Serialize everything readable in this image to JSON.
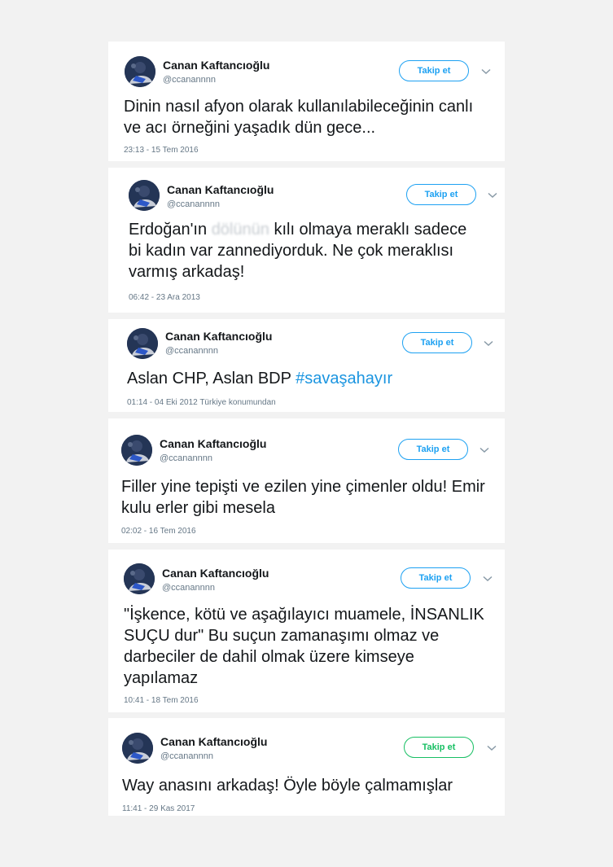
{
  "colors": {
    "accent": "#1da1f2",
    "hashtag": "#1b95e0",
    "follow_green": "#17bf63",
    "meta": "#657786"
  },
  "tweets": [
    {
      "name": "Canan Kaftancıoğlu",
      "handle": "@ccanannnn",
      "follow": "Takip et",
      "text": "Dinin nasıl afyon olarak kullanılabileceğinin canlı ve acı örneğini yaşadık dün gece...",
      "meta": "23:13 - 15 Tem 2016"
    },
    {
      "name": "Canan Kaftancıoğlu",
      "handle": "@ccanannnn",
      "follow": "Takip et",
      "text_before": "Erdoğan'ın",
      "text_blurred": "dölünün",
      "text_after": "kılı olmaya meraklı sadece bi kadın var zannediyorduk. Ne çok meraklısı varmış arkadaş!",
      "meta": "06:42 - 23 Ara 2013"
    },
    {
      "name": "Canan Kaftancıoğlu",
      "handle": "@ccanannnn",
      "follow": "Takip et",
      "text": "Aslan CHP, Aslan BDP",
      "hashtag": "#savaşahayır",
      "meta": "01:14 - 04 Eki 2012 Türkiye konumundan"
    },
    {
      "name": "Canan Kaftancıoğlu",
      "handle": "@ccanannnn",
      "follow": "Takip et",
      "text": "Filler yine tepişti ve ezilen yine çimenler oldu! Emir kulu erler gibi mesela",
      "meta": "02:02 - 16 Tem 2016"
    },
    {
      "name": "Canan Kaftancıoğlu",
      "handle": "@ccanannnn",
      "follow": "Takip et",
      "text": "\"İşkence, kötü ve aşağılayıcı muamele, İNSANLIK SUÇU dur\" Bu suçun zamanaşımı olmaz ve darbeciler de dahil olmak üzere kimseye yapılamaz",
      "meta": "10:41 - 18 Tem 2016"
    },
    {
      "name": "Canan Kaftancıoğlu",
      "handle": "@ccanannnn",
      "follow": "Takip et",
      "text": "Way anasını arkadaş! Öyle böyle çalmamışlar",
      "meta": "11:41 - 29 Kas 2017"
    }
  ]
}
